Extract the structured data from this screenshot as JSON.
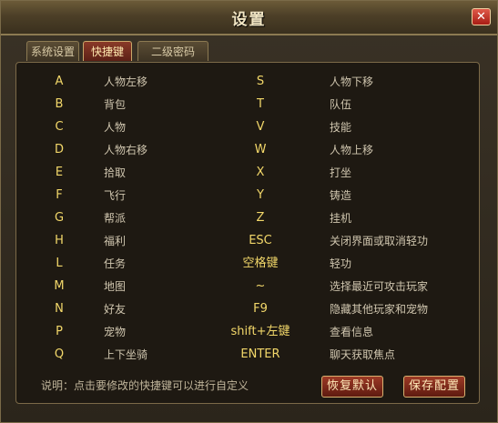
{
  "window": {
    "title": "设置",
    "close_icon": "close-icon"
  },
  "tabs": [
    {
      "label": "系统设置"
    },
    {
      "label": "快捷键"
    },
    {
      "label": "二级密码"
    }
  ],
  "rows": [
    {
      "key1": "A",
      "action1": "人物左移",
      "key2": "S",
      "action2": "人物下移"
    },
    {
      "key1": "B",
      "action1": "背包",
      "key2": "T",
      "action2": "队伍"
    },
    {
      "key1": "C",
      "action1": "人物",
      "key2": "V",
      "action2": "技能"
    },
    {
      "key1": "D",
      "action1": "人物右移",
      "key2": "W",
      "action2": "人物上移"
    },
    {
      "key1": "E",
      "action1": "拾取",
      "key2": "X",
      "action2": "打坐"
    },
    {
      "key1": "F",
      "action1": "飞行",
      "key2": "Y",
      "action2": "铸造"
    },
    {
      "key1": "G",
      "action1": "帮派",
      "key2": "Z",
      "action2": "挂机"
    },
    {
      "key1": "H",
      "action1": "福利",
      "key2": "ESC",
      "action2": "关闭界面或取消轻功"
    },
    {
      "key1": "L",
      "action1": "任务",
      "key2": "空格键",
      "action2": "轻功"
    },
    {
      "key1": "M",
      "action1": "地图",
      "key2": "~",
      "action2": "选择最近可攻击玩家"
    },
    {
      "key1": "N",
      "action1": "好友",
      "key2": "F9",
      "action2": "隐藏其他玩家和宠物"
    },
    {
      "key1": "P",
      "action1": "宠物",
      "key2": "shift+左键",
      "action2": "查看信息"
    },
    {
      "key1": "Q",
      "action1": "上下坐骑",
      "key2": "ENTER",
      "action2": "聊天获取焦点"
    }
  ],
  "footer": {
    "note": "说明：点击要修改的快捷键可以进行自定义",
    "restore_label": "恢复默认",
    "save_label": "保存配置"
  }
}
